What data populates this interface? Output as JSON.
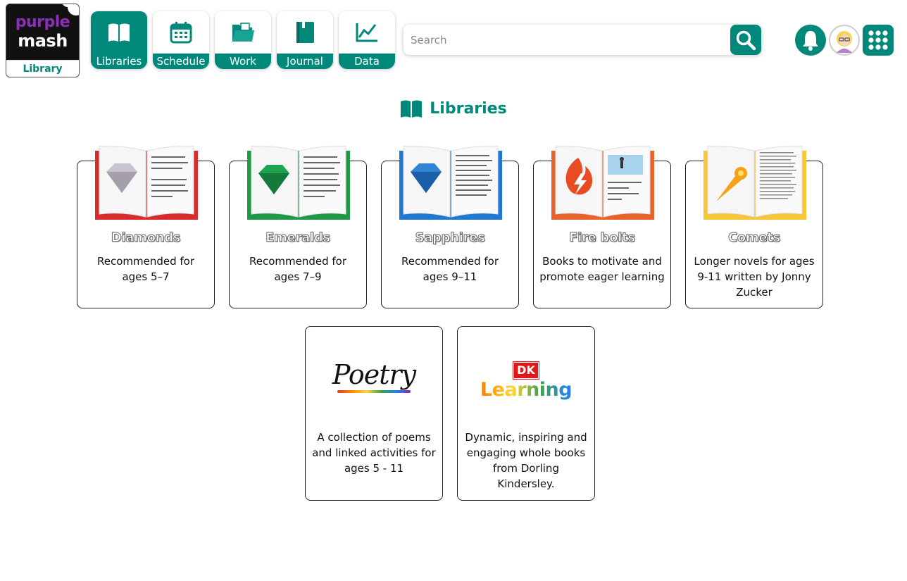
{
  "logo": {
    "line1": "purple",
    "line2": "mash",
    "tagline": "Library"
  },
  "nav": [
    {
      "label": "Libraries",
      "icon": "book-icon",
      "active": true
    },
    {
      "label": "Schedule",
      "icon": "calendar-icon",
      "active": false
    },
    {
      "label": "Work",
      "icon": "folder-icon",
      "active": false
    },
    {
      "label": "Journal",
      "icon": "journal-icon",
      "active": false
    },
    {
      "label": "Data",
      "icon": "chart-icon",
      "active": false
    }
  ],
  "search": {
    "placeholder": "Search",
    "value": ""
  },
  "heading": {
    "title": "Libraries"
  },
  "libraries": [
    {
      "name": "Diamonds",
      "desc": "Recommended for ages 5–7",
      "color": "#d92b2b",
      "gem": "#c8c3cc"
    },
    {
      "name": "Emeralds",
      "desc": "Recommended for ages 7–9",
      "color": "#1e9a46",
      "gem": "#1fa352"
    },
    {
      "name": "Sapphires",
      "desc": "Recommended for ages 9–11",
      "color": "#1f78d1",
      "gem": "#2f84d6"
    },
    {
      "name": "Fire bolts",
      "desc": "Books to motivate and promote eager learning",
      "color": "#e8622a",
      "gem": "#e94b22"
    },
    {
      "name": "Comets",
      "desc": "Longer novels for ages 9-11 written by Jonny Zucker",
      "color": "#f6c634",
      "gem": "#f7a11a"
    }
  ],
  "collections": [
    {
      "logo_text": "Poetry",
      "desc": "A collection of poems and linked activities for ages 5 - 11"
    },
    {
      "logo_badge": "DK",
      "logo_text": "Learning",
      "desc": "Dynamic, inspiring and engaging whole books from Dorling Kindersley."
    }
  ],
  "colors": {
    "accent": "#00897b",
    "brand_purple": "#8b2fb8"
  }
}
